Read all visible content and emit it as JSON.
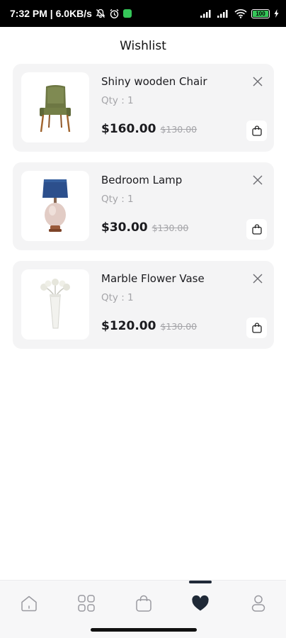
{
  "status_bar": {
    "time_speed": "7:32 PM | 6.0KB/s",
    "battery_level": "100",
    "battery_color": "#35c759"
  },
  "header": {
    "title": "Wishlist"
  },
  "items": [
    {
      "name": "Shiny wooden Chair",
      "qty": "Qty : 1",
      "price": "$160.00",
      "old_price": "$130.00",
      "image_icon": "chair-image"
    },
    {
      "name": "Bedroom Lamp",
      "qty": "Qty : 1",
      "price": "$30.00",
      "old_price": "$130.00",
      "image_icon": "lamp-image"
    },
    {
      "name": "Marble Flower Vase",
      "qty": "Qty : 1",
      "price": "$120.00",
      "old_price": "$130.00",
      "image_icon": "vase-image"
    }
  ],
  "bottom_nav": {
    "items": [
      {
        "icon": "home-icon"
      },
      {
        "icon": "grid-icon"
      },
      {
        "icon": "bag-icon"
      },
      {
        "icon": "heart-icon",
        "active": true
      },
      {
        "icon": "profile-icon"
      }
    ],
    "active_color": "#1f2937"
  }
}
